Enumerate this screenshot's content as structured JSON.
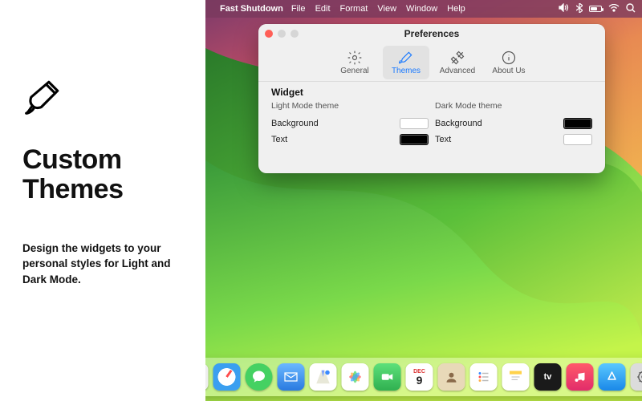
{
  "left": {
    "title_line1": "Custom",
    "title_line2": "Themes",
    "description": "Design the widgets to your personal styles for Light and Dark Mode."
  },
  "menubar": {
    "app_name": "Fast Shutdown",
    "items": [
      "File",
      "Edit",
      "Format",
      "View",
      "Window",
      "Help"
    ]
  },
  "preferences": {
    "title": "Preferences",
    "tabs": [
      {
        "label": "General",
        "icon": "gear"
      },
      {
        "label": "Themes",
        "icon": "brush",
        "selected": true
      },
      {
        "label": "Advanced",
        "icon": "tools"
      },
      {
        "label": "About Us",
        "icon": "info"
      }
    ],
    "section": "Widget",
    "light": {
      "heading": "Light Mode theme",
      "rows": [
        {
          "label": "Background",
          "color": "#ffffff"
        },
        {
          "label": "Text",
          "color": "#000000"
        }
      ]
    },
    "dark": {
      "heading": "Dark Mode theme",
      "rows": [
        {
          "label": "Background",
          "color": "#000000"
        },
        {
          "label": "Text",
          "color": "#ffffff"
        }
      ]
    }
  },
  "dock": {
    "calendar": {
      "month": "DEC",
      "day": "9"
    }
  }
}
